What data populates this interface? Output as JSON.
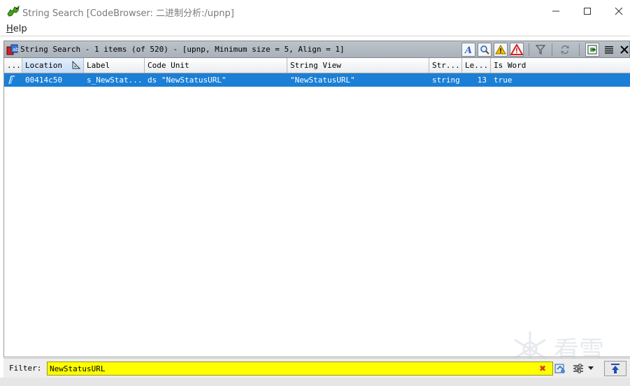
{
  "window": {
    "title": "String Search [CodeBrowser: 二进制分析:/upnp]",
    "icon": "ghidra-dragon-icon"
  },
  "menu": {
    "help_label_underlined": "H",
    "help_label_rest": "elp"
  },
  "panel": {
    "title": "String Search - 1 items (of 520) - [upnp, Minimum size = 5, Align = 1]",
    "toolbar_icons": [
      "string-type-icon",
      "search-magnifier-icon",
      "warning-icon",
      "error-icon",
      "filter-funnel-icon",
      "refresh-icon",
      "make-selection-icon",
      "table-options-icon",
      "close-icon"
    ]
  },
  "table": {
    "columns": [
      "...",
      "Location",
      "Label",
      "Code Unit",
      "String View",
      "Str...",
      "Le...",
      "Is Word"
    ],
    "sorted_column": "Location",
    "rows": [
      {
        "icon": "string-row-icon",
        "location": "00414c50",
        "label": "s_NewStat...",
        "code_unit": "ds \"NewStatusURL\"",
        "string_view": "\"NewStatusURL\"",
        "string_type": "string",
        "length": "13",
        "is_word": "true"
      }
    ]
  },
  "filter": {
    "label": "Filter:",
    "value": "NewStatusURL"
  },
  "watermark": {
    "text": "看雪"
  },
  "colors": {
    "selection": "#1b7fd6",
    "filter_highlight": "#ffff00",
    "header_gradient_top": "#bcc3cb"
  }
}
